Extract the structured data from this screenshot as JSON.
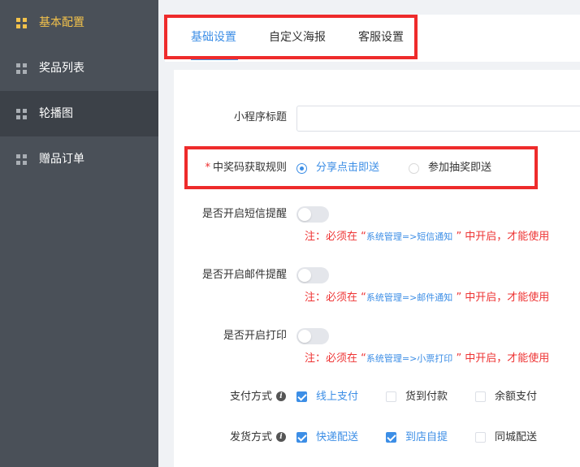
{
  "sidebar": {
    "items": [
      {
        "label": "基本配置"
      },
      {
        "label": "奖品列表"
      },
      {
        "label": "轮播图"
      },
      {
        "label": "赠品订单"
      }
    ]
  },
  "tabs": [
    {
      "label": "基础设置"
    },
    {
      "label": "自定义海报"
    },
    {
      "label": "客服设置"
    }
  ],
  "form": {
    "title_label": "小程序标题",
    "title_value": "",
    "code_rule": {
      "required_mark": "*",
      "label": "中奖码获取规则",
      "options": [
        {
          "label": "分享点击即送",
          "selected": true
        },
        {
          "label": "参加抽奖即送",
          "selected": false
        }
      ]
    },
    "sms": {
      "label": "是否开启短信提醒",
      "enabled": false,
      "note_prefix": "注：必须在 “",
      "note_path": "系统管理=>短信通知",
      "note_suffix": " ” 中开启，才能使用"
    },
    "email": {
      "label": "是否开启邮件提醒",
      "enabled": false,
      "note_prefix": "注：必须在 “",
      "note_path": "系统管理=>邮件通知",
      "note_suffix": " ” 中开启，才能使用"
    },
    "print": {
      "label": "是否开启打印",
      "enabled": false,
      "note_prefix": "注：必须在 “",
      "note_path": "系统管理=>小票打印",
      "note_suffix": " ” 中开启，才能使用"
    },
    "payment": {
      "label": "支付方式",
      "info_glyph": "i",
      "options": [
        {
          "label": "线上支付",
          "checked": true
        },
        {
          "label": "货到付款",
          "checked": false
        },
        {
          "label": "余额支付",
          "checked": false
        }
      ]
    },
    "delivery": {
      "label": "发货方式",
      "info_glyph": "i",
      "options": [
        {
          "label": "快递配送",
          "checked": true
        },
        {
          "label": "到店自提",
          "checked": true
        },
        {
          "label": "同城配送",
          "checked": false
        }
      ]
    }
  },
  "colors": {
    "accent": "#3c8ee6",
    "highlight": "#ee2b2b",
    "sidebar_bg": "#4a5058",
    "sidebar_active": "#f3c24b",
    "note": "#ee3333"
  }
}
